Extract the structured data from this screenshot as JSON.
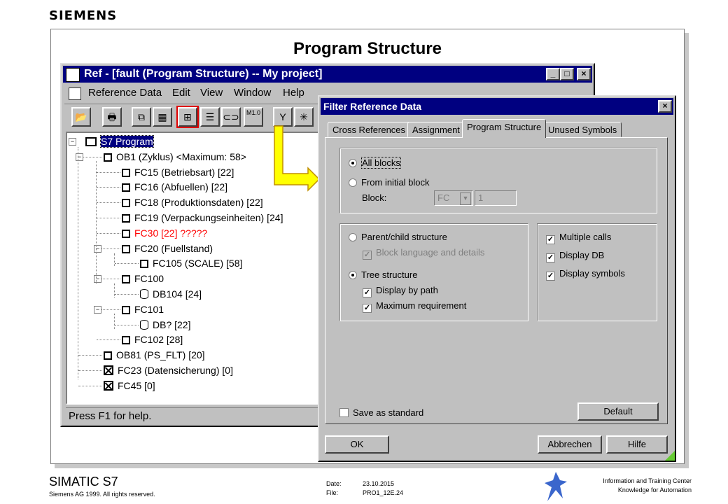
{
  "brand": "SIEMENS",
  "slide_title": "Program Structure",
  "main_window": {
    "title": "Ref - [fault (Program Structure) -- My project]",
    "menu": [
      "Reference Data",
      "Edit",
      "View",
      "Window",
      "Help"
    ],
    "status": "Press F1 for help.",
    "toolbar_mio": "M1.0"
  },
  "tree": [
    {
      "label": "S7 Program",
      "level": 0,
      "icon": "folder",
      "selected": true,
      "toggle": "-"
    },
    {
      "label": "OB1 (Zyklus) <Maximum: 58>",
      "level": 1,
      "icon": "box",
      "toggle": "-"
    },
    {
      "label": "FC15 (Betriebsart)  [22]",
      "level": 2,
      "icon": "box"
    },
    {
      "label": "FC16 (Abfuellen)  [22]",
      "level": 2,
      "icon": "box"
    },
    {
      "label": "FC18 (Produktionsdaten)  [22]",
      "level": 2,
      "icon": "box"
    },
    {
      "label": "FC19 (Verpackungseinheiten)  [24]",
      "level": 2,
      "icon": "box"
    },
    {
      "label": "FC30  [22] ?????",
      "level": 2,
      "icon": "box",
      "error": true
    },
    {
      "label": "FC20 (Fuellstand)",
      "level": 2,
      "icon": "box",
      "toggle": "-"
    },
    {
      "label": "FC105 (SCALE)  [58]",
      "level": 3,
      "icon": "box"
    },
    {
      "label": "FC100",
      "level": 2,
      "icon": "box",
      "toggle": "-"
    },
    {
      "label": "DB104  [24]",
      "level": 3,
      "icon": "db"
    },
    {
      "label": "FC101",
      "level": 2,
      "icon": "box",
      "toggle": "-"
    },
    {
      "label": "DB?  [22]",
      "level": 3,
      "icon": "db"
    },
    {
      "label": "FC102  [28]",
      "level": 2,
      "icon": "box"
    },
    {
      "label": "OB81 (PS_FLT) [20]",
      "level": 1,
      "icon": "box"
    },
    {
      "label": "FC23 (Datensicherung) [0]",
      "level": 1,
      "icon": "xbox"
    },
    {
      "label": "FC45    [0]",
      "level": 1,
      "icon": "xbox"
    }
  ],
  "dialog": {
    "title": "Filter Reference Data",
    "tabs": [
      "Cross References",
      "Assignment",
      "Program Structure",
      "Unused Symbols"
    ],
    "active_tab": "Program Structure",
    "all_blocks": "All blocks",
    "from_initial": "From initial block",
    "block_label": "Block:",
    "block_type": "FC",
    "block_number": "1",
    "parent_child": "Parent/child structure",
    "block_language": "Block language and details",
    "tree_structure": "Tree structure",
    "display_by_path": "Display by path",
    "max_requirement": "Maximum requirement",
    "multiple_calls": "Multiple calls",
    "display_db": "Display DB",
    "display_symbols": "Display symbols",
    "save_standard": "Save as standard",
    "default_btn": "Default",
    "ok_btn": "OK",
    "cancel_btn": "Abbrechen",
    "help_btn": "Hilfe"
  },
  "footer": {
    "product": "SIMATIC S7",
    "copyright": "Siemens AG 1999. All rights reserved.",
    "date_label": "Date:",
    "date_value": "23.10.2015",
    "file_label": "File:",
    "file_value": "PRO1_12E.24",
    "center_line1": "Information and Training Center",
    "center_line2": "Knowledge for Automation"
  },
  "colors": {
    "titlebar": "#000080",
    "error_text": "#ff0000",
    "arrow_fill": "#ffff00",
    "selection": "#000080"
  }
}
